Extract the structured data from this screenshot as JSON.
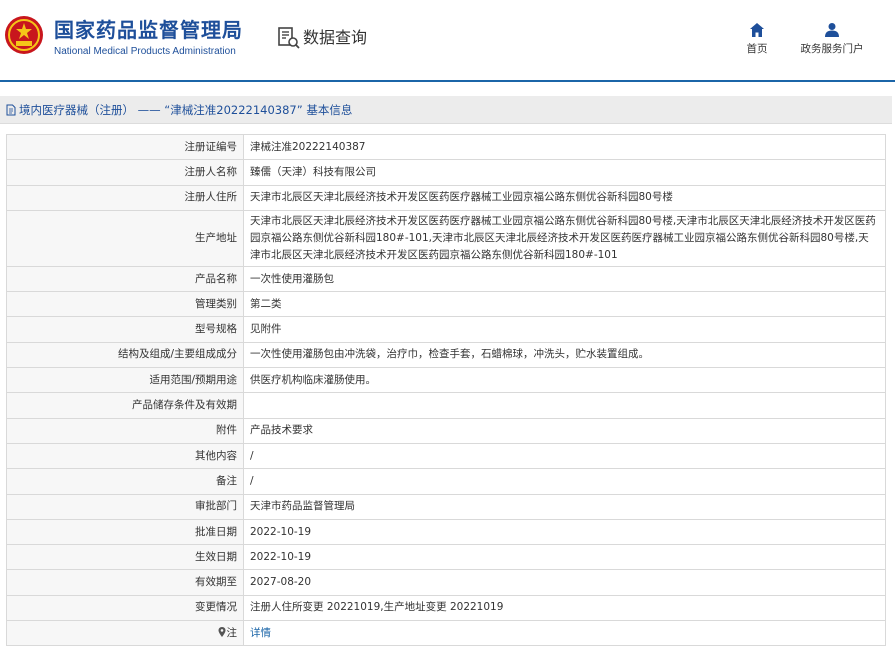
{
  "header": {
    "title_cn": "国家药品监督管理局",
    "title_en": "National Medical Products Administration",
    "query_label": "数据查询",
    "nav": [
      {
        "label": "首页",
        "icon": "home-icon"
      },
      {
        "label": "政务服务门户",
        "icon": "user-icon"
      }
    ]
  },
  "breadcrumb": {
    "text": "境内医疗器械（注册） —— “津械注准20222140387” 基本信息"
  },
  "colors": {
    "brand_blue": "#1e4f9a",
    "header_rule": "#1b65a8",
    "link": "#1b65a8",
    "label_bg": "#f7f7f7",
    "border": "#d9d9d9"
  },
  "rows": [
    {
      "label": "注册证编号",
      "value": "津械注准20222140387"
    },
    {
      "label": "注册人名称",
      "value": "臻儒（天津）科技有限公司"
    },
    {
      "label": "注册人住所",
      "value": "天津市北辰区天津北辰经济技术开发区医药医疗器械工业园京福公路东侧优谷新科园80号楼"
    },
    {
      "label": "生产地址",
      "value": "天津市北辰区天津北辰经济技术开发区医药医疗器械工业园京福公路东侧优谷新科园80号楼,天津市北辰区天津北辰经济技术开发区医药园京福公路东侧优谷新科园180#-101,天津市北辰区天津北辰经济技术开发区医药医疗器械工业园京福公路东侧优谷新科园80号楼,天津市北辰区天津北辰经济技术开发区医药园京福公路东侧优谷新科园180#-101"
    },
    {
      "label": "产品名称",
      "value": "一次性使用灌肠包"
    },
    {
      "label": "管理类别",
      "value": "第二类"
    },
    {
      "label": "型号规格",
      "value": "见附件"
    },
    {
      "label": "结构及组成/主要组成成分",
      "value": "一次性使用灌肠包由冲洗袋，治疗巾，检查手套，石蜡棉球，冲洗头，贮水装置组成。"
    },
    {
      "label": "适用范围/预期用途",
      "value": "供医疗机构临床灌肠使用。"
    },
    {
      "label": "产品储存条件及有效期",
      "value": ""
    },
    {
      "label": "附件",
      "value": "产品技术要求"
    },
    {
      "label": "其他内容",
      "value": "/"
    },
    {
      "label": "备注",
      "value": "/"
    },
    {
      "label": "审批部门",
      "value": "天津市药品监督管理局"
    },
    {
      "label": "批准日期",
      "value": "2022-10-19"
    },
    {
      "label": "生效日期",
      "value": "2022-10-19"
    },
    {
      "label": "有效期至",
      "value": "2027-08-20"
    },
    {
      "label": "变更情况",
      "value": "注册人住所变更 20221019,生产地址变更 20221019"
    },
    {
      "label": "注",
      "value": "详情",
      "icon": "map-pin-icon"
    }
  ]
}
